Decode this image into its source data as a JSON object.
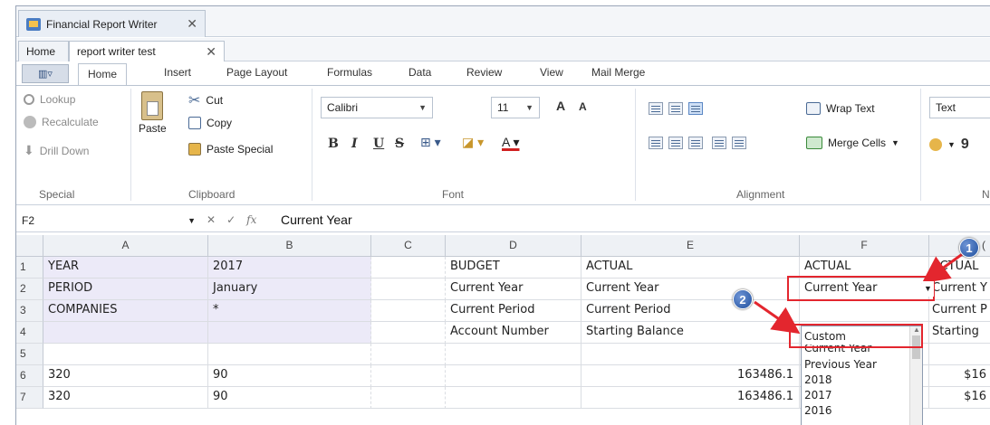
{
  "window": {
    "title": "Financial Report Writer"
  },
  "doc_tabs": [
    {
      "label": "Home"
    },
    {
      "label": "report writer test"
    }
  ],
  "ribbon_tabs": [
    "Home",
    "Insert",
    "Page Layout",
    "Formulas",
    "Data",
    "Review",
    "View",
    "Mail Merge"
  ],
  "ribbon": {
    "special": {
      "label": "Special",
      "items": [
        "Lookup",
        "Recalculate",
        "Drill Down"
      ]
    },
    "clipboard": {
      "label": "Clipboard",
      "paste": "Paste",
      "cut": "Cut",
      "copy": "Copy",
      "paste_special": "Paste Special"
    },
    "font": {
      "label": "Font",
      "name": "Calibri",
      "size": "11",
      "bold": "B",
      "italic": "I",
      "underline": "U",
      "strike": "S",
      "grow": "A",
      "shrink": "A"
    },
    "alignment": {
      "label": "Alignment",
      "wrap_text": "Wrap Text",
      "merge_cells": "Merge Cells"
    },
    "number": {
      "format": "Text",
      "label_fragment": "N",
      "symbol": "9"
    }
  },
  "formula_bar": {
    "cell_ref": "F2",
    "value": "Current Year"
  },
  "grid": {
    "columns": [
      "A",
      "B",
      "C",
      "D",
      "E",
      "F",
      "G"
    ],
    "column_g_header": "(",
    "rows": [
      {
        "n": "1",
        "a": "YEAR",
        "b": "2017",
        "d": "BUDGET",
        "e": "ACTUAL",
        "f": "ACTUAL",
        "g": "ACTUAL"
      },
      {
        "n": "2",
        "a": "PERIOD",
        "b": "January",
        "d": "Current Year",
        "e": "Current Year",
        "f": "Current Year",
        "g": "Current Y"
      },
      {
        "n": "3",
        "a": "COMPANIES",
        "b": "*",
        "d": "Current Period",
        "e": "Current Period",
        "f": "",
        "g": "Current P"
      },
      {
        "n": "4",
        "a": "",
        "b": "",
        "d": "Account Number",
        "e": "Starting Balance",
        "f": "",
        "g": "Starting"
      },
      {
        "n": "5",
        "a": "",
        "b": "",
        "d": "",
        "e": "",
        "f": "",
        "g": ""
      },
      {
        "n": "6",
        "a": "320",
        "b": "90",
        "d": "",
        "e": "163486.1",
        "f": "",
        "g": "$16"
      },
      {
        "n": "7",
        "a": "320",
        "b": "90",
        "d": "",
        "e": "163486.1",
        "f": "",
        "g": "$16"
      }
    ]
  },
  "dropdown": {
    "options": [
      "Custom",
      "Current Year",
      "Previous Year",
      "2018",
      "2017",
      "2016"
    ]
  },
  "callouts": [
    "1",
    "2"
  ],
  "colors": {
    "highlight_red": "#e3262e",
    "badge_blue": "#1f4f9d",
    "selected_range": "#eceaf8"
  }
}
